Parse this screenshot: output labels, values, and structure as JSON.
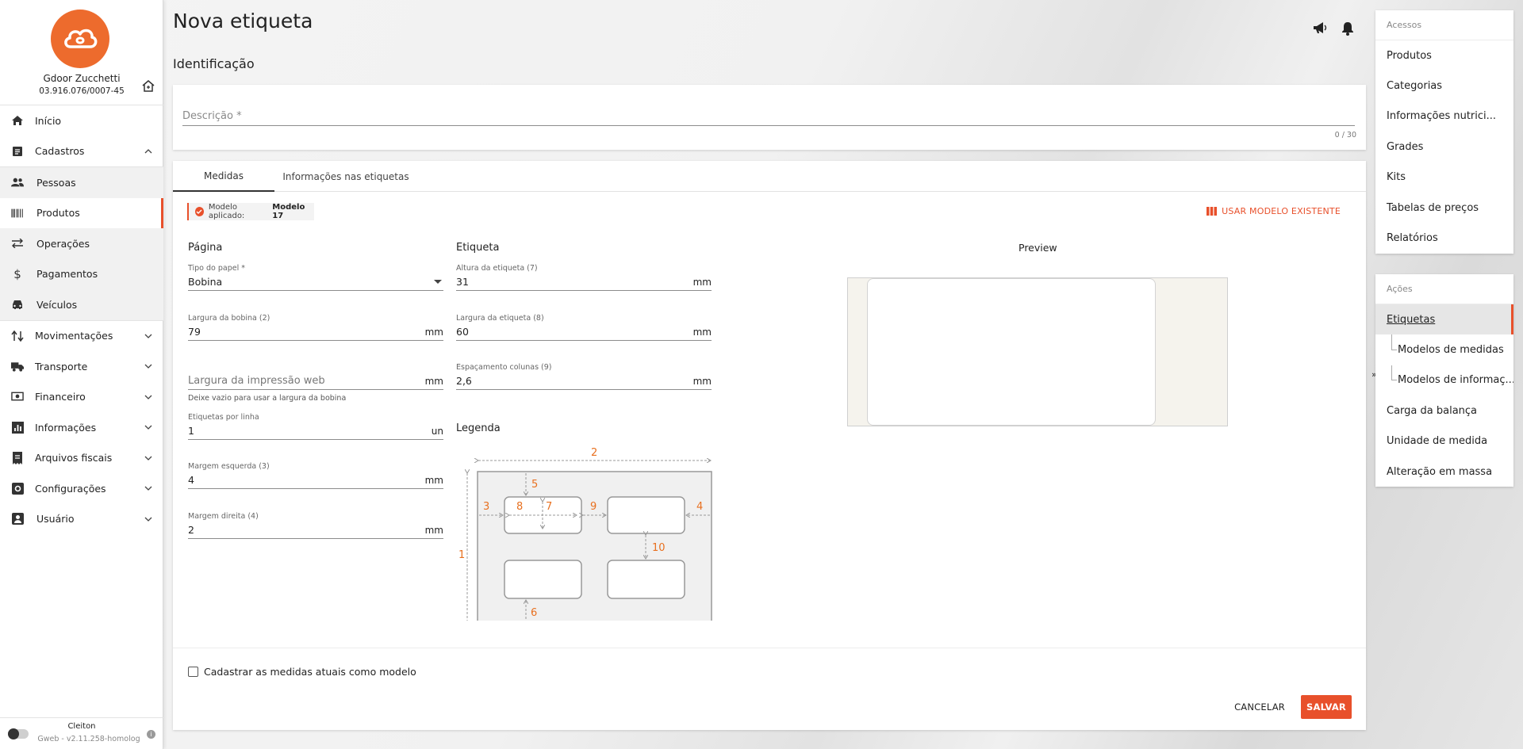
{
  "company": {
    "name": "Gdoor Zucchetti",
    "cnpj": "03.916.076/0007-45"
  },
  "nav": {
    "inicio": "Início",
    "cadastros": "Cadastros",
    "pessoas": "Pessoas",
    "produtos": "Produtos",
    "operacoes": "Operações",
    "pagamentos": "Pagamentos",
    "veiculos": "Veículos",
    "movimentacoes": "Movimentações",
    "transporte": "Transporte",
    "financeiro": "Financeiro",
    "informacoes": "Informações",
    "arquivos_fiscais": "Arquivos fiscais",
    "configuracoes": "Configurações",
    "usuario": "Usuário"
  },
  "footer": {
    "user": "Cleiton",
    "version": "Gweb - v2.11.258-homolog"
  },
  "page": {
    "title": "Nova etiqueta",
    "section": "Identificação"
  },
  "description": {
    "placeholder": "Descrição *",
    "value": "",
    "counter": "0 / 30"
  },
  "tabs": {
    "medidas": "Medidas",
    "informacoes": "Informações nas etiquetas"
  },
  "model": {
    "label": "Modelo aplicado:",
    "name": "Modelo 17",
    "use_existing": "USAR MODELO EXISTENTE"
  },
  "pagina": {
    "title": "Página",
    "tipo_papel": {
      "label": "Tipo do papel *",
      "value": "Bobina"
    },
    "largura_bobina": {
      "label": "Largura da bobina (2)",
      "value": "79",
      "unit": "mm"
    },
    "largura_impressao": {
      "placeholder": "Largura da impressão web",
      "unit": "mm",
      "hint": "Deixe vazio para usar a largura da bobina"
    },
    "etiquetas_linha": {
      "label": "Etiquetas por linha",
      "value": "1",
      "unit": "un"
    },
    "margem_esquerda": {
      "label": "Margem esquerda (3)",
      "value": "4",
      "unit": "mm"
    },
    "margem_direita": {
      "label": "Margem direita (4)",
      "value": "2",
      "unit": "mm"
    }
  },
  "etiqueta": {
    "title": "Etiqueta",
    "altura": {
      "label": "Altura da etiqueta (7)",
      "value": "31",
      "unit": "mm"
    },
    "largura": {
      "label": "Largura da etiqueta (8)",
      "value": "60",
      "unit": "mm"
    },
    "espacamento": {
      "label": "Espaçamento colunas (9)",
      "value": "2,6",
      "unit": "mm"
    }
  },
  "legenda": {
    "title": "Legenda",
    "n1": "1",
    "n2": "2",
    "n3": "3",
    "n4": "4",
    "n5": "5",
    "n6": "6",
    "n7": "7",
    "n8": "8",
    "n9": "9",
    "n10": "10"
  },
  "preview": {
    "title": "Preview"
  },
  "save_as_model": "Cadastrar as medidas atuais como modelo",
  "buttons": {
    "cancel": "CANCELAR",
    "save": "SALVAR"
  },
  "acessos": {
    "title": "Acessos",
    "items": [
      "Produtos",
      "Categorias",
      "Informações nutrici...",
      "Grades",
      "Kits",
      "Tabelas de preços",
      "Relatórios"
    ]
  },
  "acoes": {
    "title": "Ações",
    "items": [
      "Etiquetas",
      "Modelos de medidas",
      "Modelos de informaç...",
      "Carga da balança",
      "Unidade de medida",
      "Alteração em massa"
    ]
  },
  "colors": {
    "accent": "#e8502b",
    "logo": "#ed6b2d",
    "legend": "#e8701f"
  },
  "icons": {
    "header": [
      "megaphone-icon",
      "bell-icon"
    ],
    "nav": [
      "home-icon",
      "list-icon",
      "people-icon",
      "barcode-icon",
      "swap-icon",
      "dollar-icon",
      "car-icon",
      "transfer-icon",
      "truck-icon",
      "money-icon",
      "chart-icon",
      "receipt-icon",
      "settings-icon",
      "user-icon"
    ]
  }
}
